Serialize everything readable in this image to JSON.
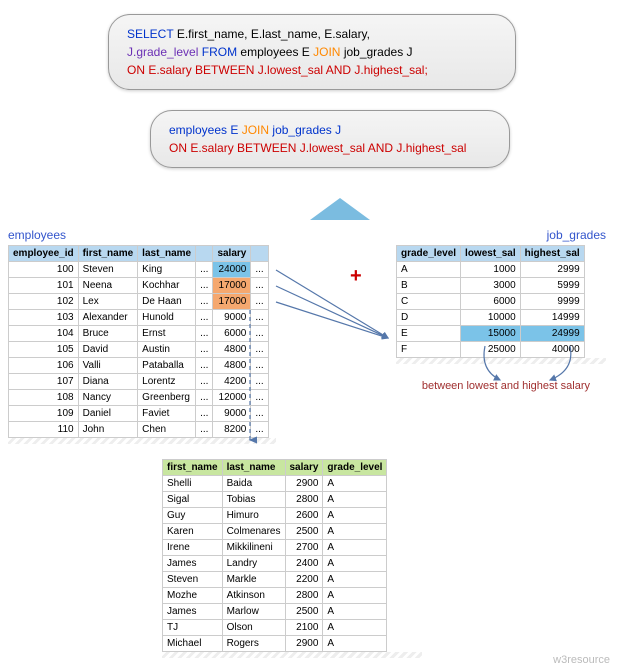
{
  "sql_bubble": {
    "select": "SELECT",
    "from": "FROM",
    "join": "JOIN",
    "cols": "E.first_name, E.last_name, E.salary,",
    "grade": "J.grade_level",
    "t_emp": "employees E",
    "t_job": "job_grades J",
    "on": "ON",
    "on_expr": "E.salary BETWEEN J.lowest_sal AND J.highest_sal;"
  },
  "sub_bubble": {
    "t_emp": "employees E",
    "join": "JOIN",
    "t_job": "job_grades J",
    "on": "ON",
    "on_expr": "E.salary BETWEEN J.lowest_sal AND J.highest_sal"
  },
  "labels": {
    "employees": "employees",
    "job_grades": "job_grades",
    "plus": "+",
    "between": "between lowest and highest salary",
    "arrow": "↓",
    "watermark": "w3resource"
  },
  "emp": {
    "headers": [
      "employee_id",
      "first_name",
      "last_name",
      "",
      "salary",
      ""
    ],
    "rows": [
      {
        "id": 100,
        "fn": "Steven",
        "ln": "King",
        "sal": 24000,
        "hl": "blue"
      },
      {
        "id": 101,
        "fn": "Neena",
        "ln": "Kochhar",
        "sal": 17000,
        "hl": "orange"
      },
      {
        "id": 102,
        "fn": "Lex",
        "ln": "De Haan",
        "sal": 17000,
        "hl": "orange"
      },
      {
        "id": 103,
        "fn": "Alexander",
        "ln": "Hunold",
        "sal": 9000
      },
      {
        "id": 104,
        "fn": "Bruce",
        "ln": "Ernst",
        "sal": 6000
      },
      {
        "id": 105,
        "fn": "David",
        "ln": "Austin",
        "sal": 4800
      },
      {
        "id": 106,
        "fn": "Valli",
        "ln": "Pataballa",
        "sal": 4800
      },
      {
        "id": 107,
        "fn": "Diana",
        "ln": "Lorentz",
        "sal": 4200
      },
      {
        "id": 108,
        "fn": "Nancy",
        "ln": "Greenberg",
        "sal": 12000
      },
      {
        "id": 109,
        "fn": "Daniel",
        "ln": "Faviet",
        "sal": 9000
      },
      {
        "id": 110,
        "fn": "John",
        "ln": "Chen",
        "sal": 8200
      }
    ]
  },
  "job": {
    "headers": [
      "grade_level",
      "lowest_sal",
      "highest_sal"
    ],
    "rows": [
      {
        "g": "A",
        "lo": 1000,
        "hi": 2999
      },
      {
        "g": "B",
        "lo": 3000,
        "hi": 5999
      },
      {
        "g": "C",
        "lo": 6000,
        "hi": 9999
      },
      {
        "g": "D",
        "lo": 10000,
        "hi": 14999
      },
      {
        "g": "E",
        "lo": 15000,
        "hi": 24999,
        "hl": "blue"
      },
      {
        "g": "F",
        "lo": 25000,
        "hi": 40000
      }
    ]
  },
  "result": {
    "headers": [
      "first_name",
      "last_name",
      "salary",
      "grade_level"
    ],
    "rows": [
      {
        "fn": "Shelli",
        "ln": "Baida",
        "sal": 2900,
        "g": "A"
      },
      {
        "fn": "Sigal",
        "ln": "Tobias",
        "sal": 2800,
        "g": "A"
      },
      {
        "fn": "Guy",
        "ln": "Himuro",
        "sal": 2600,
        "g": "A"
      },
      {
        "fn": "Karen",
        "ln": "Colmenares",
        "sal": 2500,
        "g": "A"
      },
      {
        "fn": "Irene",
        "ln": "Mikkilineni",
        "sal": 2700,
        "g": "A"
      },
      {
        "fn": "James",
        "ln": "Landry",
        "sal": 2400,
        "g": "A"
      },
      {
        "fn": "Steven",
        "ln": "Markle",
        "sal": 2200,
        "g": "A"
      },
      {
        "fn": "Mozhe",
        "ln": "Atkinson",
        "sal": 2800,
        "g": "A"
      },
      {
        "fn": "James",
        "ln": "Marlow",
        "sal": 2500,
        "g": "A"
      },
      {
        "fn": "TJ",
        "ln": "Olson",
        "sal": 2100,
        "g": "A"
      },
      {
        "fn": "Michael",
        "ln": "Rogers",
        "sal": 2900,
        "g": "A"
      }
    ]
  }
}
